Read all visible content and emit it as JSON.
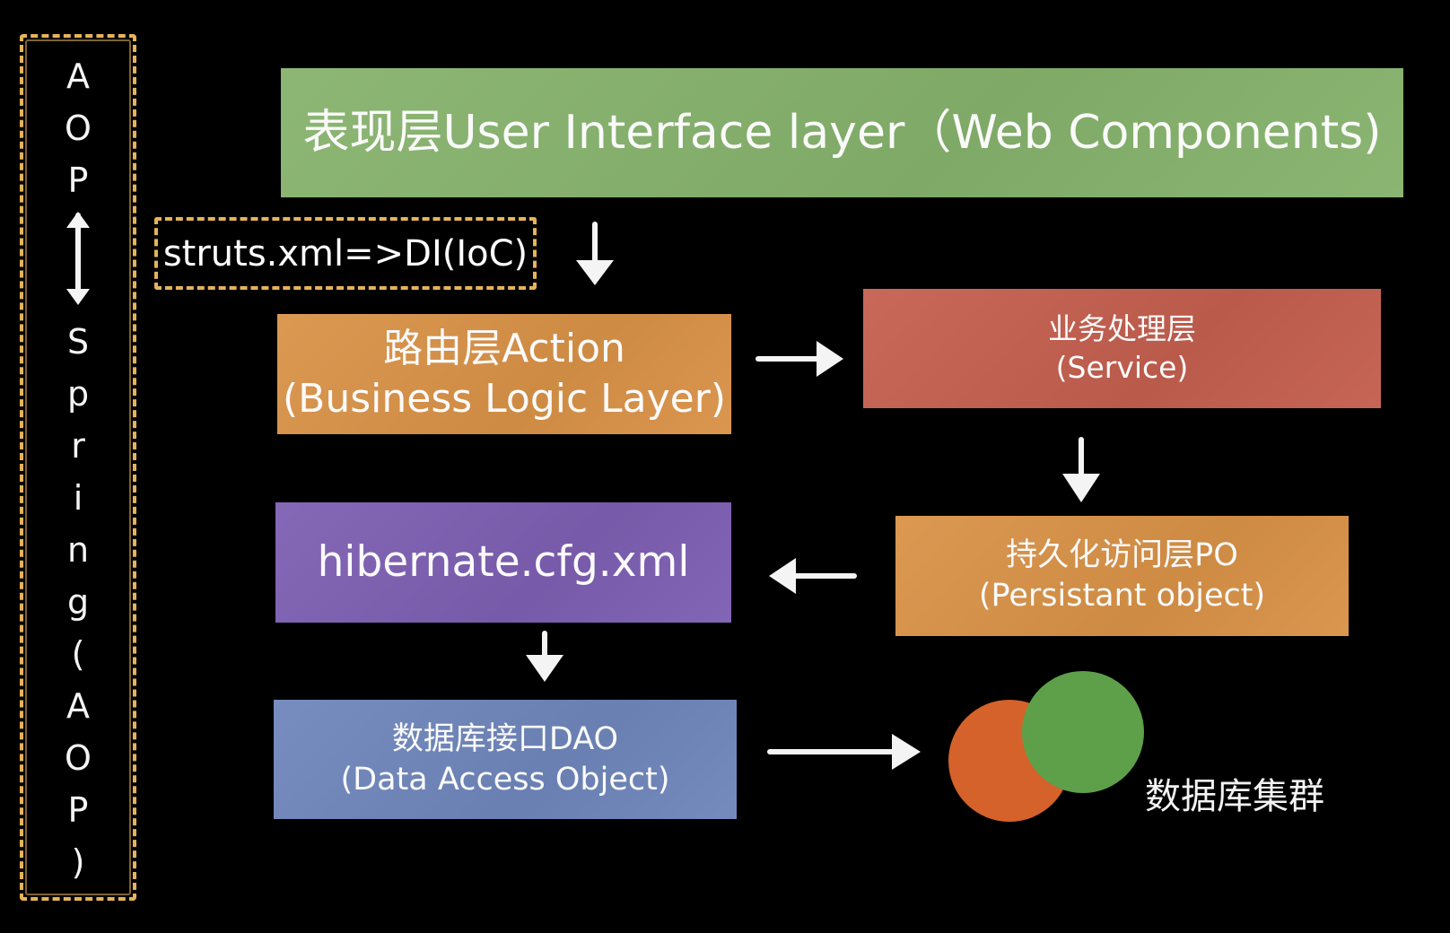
{
  "aop_sidebar": {
    "chars_top": [
      "A",
      "O",
      "P"
    ],
    "chars_bottom": [
      "S",
      "p",
      "r",
      "i",
      "n",
      "g",
      "(",
      "A",
      "O",
      "P",
      ")"
    ]
  },
  "ui_layer": {
    "text": "表现层User Interface layer（Web Components)"
  },
  "struts": {
    "text": "struts.xml=>DI(IoC)"
  },
  "action_layer": {
    "line1": "路由层Action",
    "line2": "(Business Logic Layer)"
  },
  "service_layer": {
    "line1": "业务处理层",
    "line2": "(Service)"
  },
  "po_layer": {
    "line1": "持久化访问层PO",
    "line2": "(Persistant object)"
  },
  "hibernate_layer": {
    "text": "hibernate.cfg.xml"
  },
  "dao_layer": {
    "line1": "数据库接口DAO",
    "line2": "(Data Access Object)"
  },
  "cluster": {
    "label": "数据库集群"
  },
  "colors": {
    "ui": "#86b26c",
    "action": "#d99247",
    "service": "#c45f4f",
    "po": "#d99247",
    "hibernate": "#7d5fb2",
    "dao": "#6f86bb",
    "frame": "#e6b35a",
    "db_orange": "#d4622a",
    "db_green": "#5ea049"
  }
}
